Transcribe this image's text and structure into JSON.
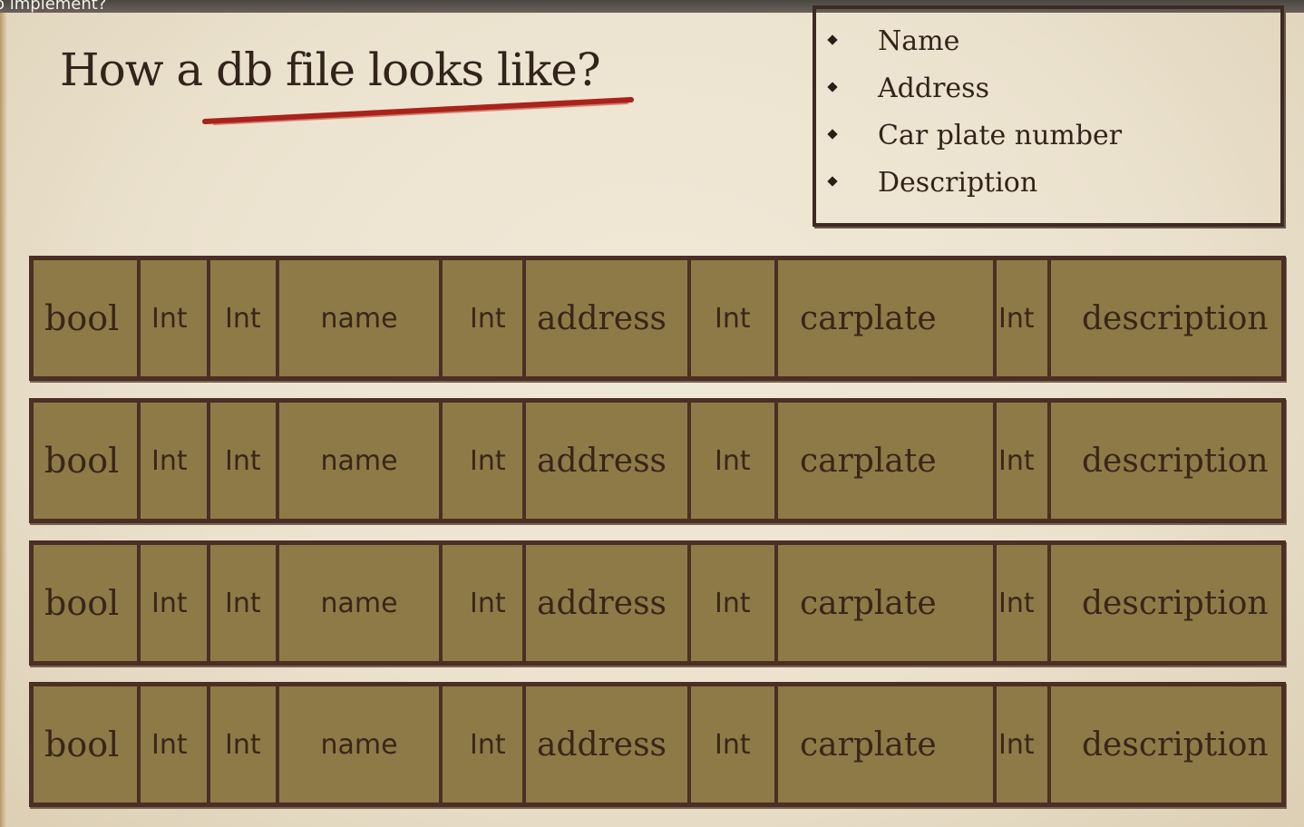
{
  "app": {
    "top_caption": "o implement?"
  },
  "slide": {
    "title": "How a db file looks like?",
    "accent_color": "#a8231b",
    "fields": [
      {
        "label": "Name"
      },
      {
        "label": "Address"
      },
      {
        "label": "Car plate number"
      },
      {
        "label": "Description"
      }
    ],
    "record_fill_color": "#8e7a47",
    "records": [
      {
        "cells": [
          "bool",
          "Int",
          "Int",
          "name",
          "Int",
          "address",
          "Int",
          "carplate",
          "Int",
          "description"
        ]
      },
      {
        "cells": [
          "bool",
          "Int",
          "Int",
          "name",
          "Int",
          "address",
          "Int",
          "carplate",
          "Int",
          "description"
        ]
      },
      {
        "cells": [
          "bool",
          "Int",
          "Int",
          "name",
          "Int",
          "address",
          "Int",
          "carplate",
          "Int",
          "description"
        ]
      },
      {
        "cells": [
          "bool",
          "Int",
          "Int",
          "name",
          "Int",
          "address",
          "Int",
          "carplate",
          "Int",
          "description"
        ]
      }
    ]
  }
}
